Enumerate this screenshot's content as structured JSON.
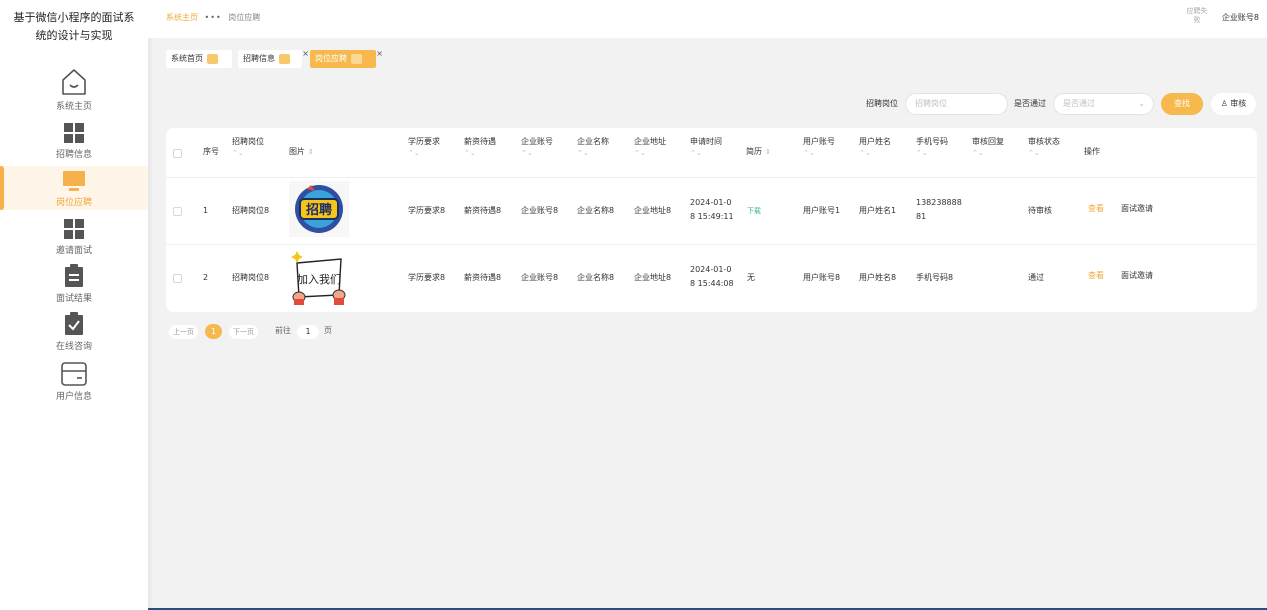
{
  "app": {
    "title": "基于微信小程序的面试系统的设计与实现",
    "title_line1": "基于微信小程序的面试系",
    "title_line2": "统的设计与实现"
  },
  "sidebar": {
    "items": [
      {
        "label": "系统主页",
        "icon": "home-icon",
        "active": false
      },
      {
        "label": "招聘信息",
        "icon": "grid-icon",
        "active": false
      },
      {
        "label": "岗位应聘",
        "icon": "monitor-icon",
        "active": true
      },
      {
        "label": "邀请面试",
        "icon": "grid-icon",
        "active": false
      },
      {
        "label": "面试结果",
        "icon": "clipboard-icon",
        "active": false
      },
      {
        "label": "在线咨询",
        "icon": "check-clipboard-icon",
        "active": false
      },
      {
        "label": "用户信息",
        "icon": "card-icon",
        "active": false
      }
    ]
  },
  "header": {
    "breadcrumb": {
      "home": "系统主页",
      "current": "岗位应聘"
    },
    "avatar_alt": "应聘失败",
    "account": "企业账号8"
  },
  "tabs": [
    {
      "label": "系统首页",
      "closable": false,
      "active": false
    },
    {
      "label": "招聘信息",
      "closable": true,
      "active": false
    },
    {
      "label": "岗位应聘",
      "closable": true,
      "active": true
    }
  ],
  "search": {
    "position_label": "招聘岗位",
    "position_placeholder": "招聘岗位",
    "passed_label": "是否通过",
    "passed_placeholder": "是否通过",
    "find_button": "查找",
    "audit_button": "审核"
  },
  "table": {
    "headers": {
      "index": "序号",
      "position": "招聘岗位",
      "image": "图片",
      "education": "学历要求",
      "salary": "薪资待遇",
      "company_account": "企业账号",
      "company_name": "企业名称",
      "company_address": "企业地址",
      "apply_time": "申请时间",
      "resume": "简历",
      "user_account": "用户账号",
      "user_name": "用户姓名",
      "phone": "手机号码",
      "audit_reply": "审核回复",
      "audit_status": "审核状态",
      "action": "操作"
    },
    "rows": [
      {
        "index": "1",
        "position": "招聘岗位8",
        "image_caption": "招聘",
        "education": "学历要求8",
        "salary": "薪资待遇8",
        "company_account": "企业账号8",
        "company_name": "企业名称8",
        "company_address": "企业地址8",
        "apply_time_1": "2024-01-0",
        "apply_time_2": "8 15:49:11",
        "resume": "下载",
        "user_account": "用户账号1",
        "user_name": "用户姓名1",
        "phone_1": "138238888",
        "phone_2": "81",
        "audit_reply": "",
        "audit_status": "待审核",
        "view": "查看",
        "invite": "面试邀请"
      },
      {
        "index": "2",
        "position": "招聘岗位8",
        "image_caption": "加入我们",
        "education": "学历要求8",
        "salary": "薪资待遇8",
        "company_account": "企业账号8",
        "company_name": "企业名称8",
        "company_address": "企业地址8",
        "apply_time_1": "2024-01-0",
        "apply_time_2": "8 15:44:08",
        "resume": "无",
        "user_account": "用户账号8",
        "user_name": "用户姓名8",
        "phone_1": "手机号码8",
        "phone_2": "",
        "audit_reply": "",
        "audit_status": "通过",
        "view": "查看",
        "invite": "面试邀请"
      }
    ]
  },
  "pagination": {
    "prev": "上一页",
    "current": "1",
    "next": "下一页",
    "goto": "前往",
    "page_value": "1",
    "page_suffix": "页"
  },
  "colors": {
    "accent": "#f7b94d",
    "accent_text": "#f0a93a",
    "green": "#41b883"
  }
}
